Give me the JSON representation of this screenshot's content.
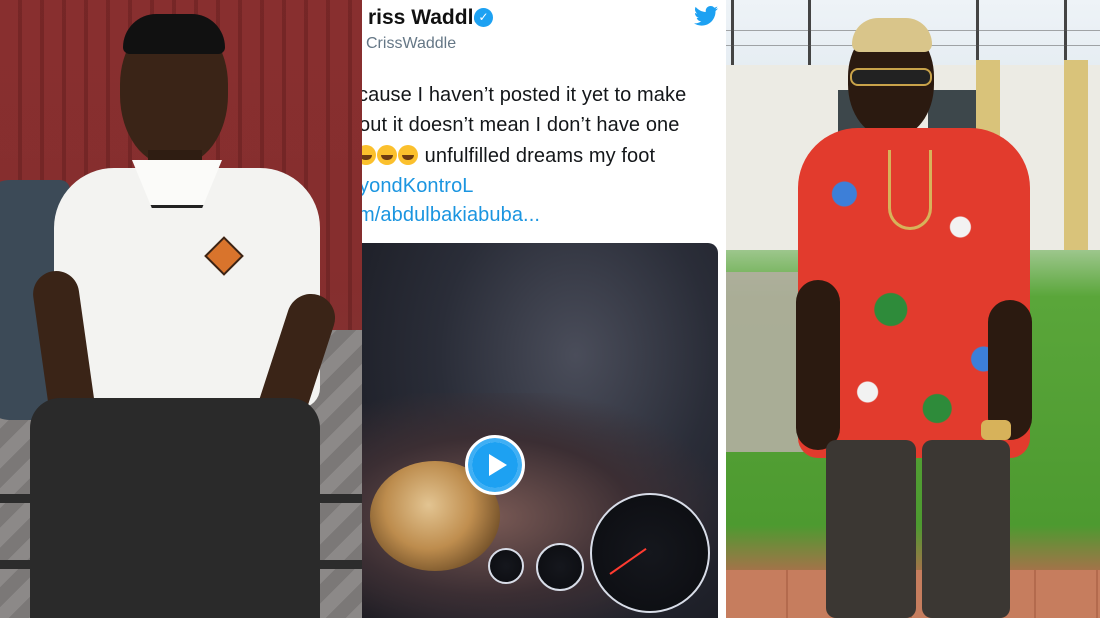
{
  "tweet": {
    "name": "riss Waddle",
    "handle": "CrissWaddle",
    "lines": [
      "cause I haven’t posted it yet to make",
      "out it doesn’t mean I don’t have one",
      "unfulfilled dreams my foot",
      "yondKontroL",
      "m/abdulbakiabuba..."
    ]
  },
  "icons": {
    "verified": "verified-badge-icon",
    "bird": "twitter-bird-icon",
    "play": "play-icon",
    "emoji": "laughing-emoji-icon"
  },
  "colors": {
    "twitter_blue": "#1da1f2",
    "link": "#1b95e0",
    "text": "#14171a",
    "handle": "#657786"
  }
}
